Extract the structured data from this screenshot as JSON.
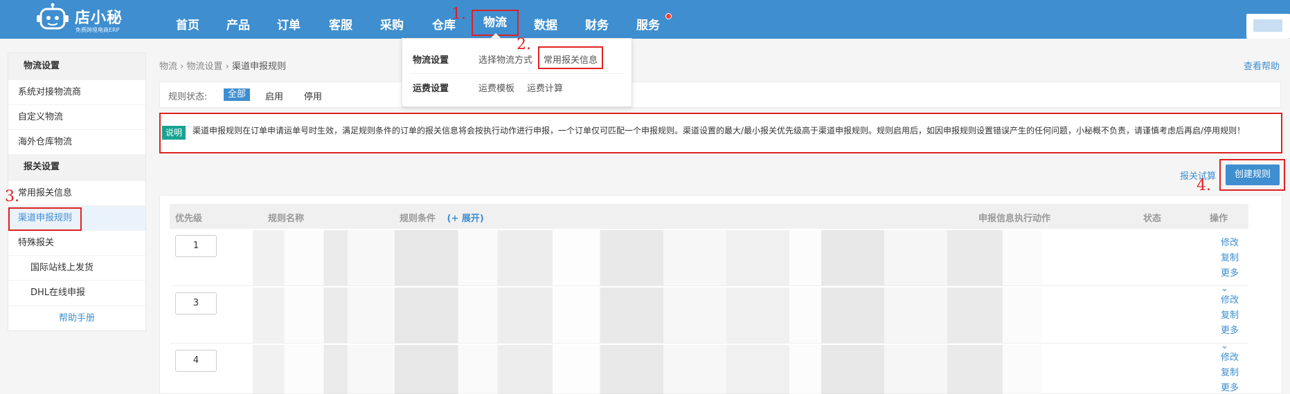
{
  "brand": {
    "title": "店小秘",
    "subtitle": "免费跨境电商ERP"
  },
  "nav": {
    "items": [
      "首页",
      "产品",
      "订单",
      "客服",
      "采购",
      "仓库",
      "物流",
      "数据",
      "财务",
      "服务"
    ],
    "active": "物流"
  },
  "dropdown": {
    "row1": {
      "head": "物流设置",
      "links": [
        "选择物流方式",
        "常用报关信息"
      ]
    },
    "row2": {
      "head": "运费设置",
      "links": [
        "运费模板",
        "运费计算"
      ]
    }
  },
  "annotations": [
    "1.",
    "2.",
    "3.",
    "4."
  ],
  "sidebar": {
    "group1": "物流设置",
    "group1_items": [
      "系统对接物流商",
      "自定义物流",
      "海外仓库物流"
    ],
    "group2": "报关设置",
    "group2_items": [
      "常用报关信息",
      "渠道申报规则",
      "特殊报关"
    ],
    "group2_sub": [
      "国际站线上发货",
      "DHL在线申报"
    ],
    "help": "帮助手册"
  },
  "breadcrumb": {
    "a": "物流",
    "b": "物流设置",
    "c": "渠道申报规则",
    "sep": "›"
  },
  "help_link": "查看帮助",
  "filter": {
    "label": "规则状态:",
    "options": [
      "全部",
      "启用",
      "停用"
    ],
    "selected": "全部"
  },
  "notice": {
    "tag": "说明",
    "text": "渠道申报规则在订单申请运单号时生效，满足规则条件的订单的报关信息将会按执行动作进行申报，一个订单仅可匹配一个申报规则。渠道设置的最大/最小报关优先级高于渠道申报规则。规则启用后，如因申报规则设置错误产生的任何问题，小秘概不负责，请谨慎考虑后再启/停用规则！"
  },
  "actions": {
    "calc": "报关试算",
    "create": "创建规则"
  },
  "table": {
    "headers": {
      "priority": "优先级",
      "name": "规则名称",
      "cond": "规则条件",
      "expand": "(+ 展开)",
      "action": "申报信息执行动作",
      "status": "状态",
      "ops": "操作"
    },
    "rows": [
      {
        "priority": "1",
        "ops": [
          "修改",
          "复制",
          "更多 ⌄"
        ]
      },
      {
        "priority": "3",
        "ops": [
          "修改",
          "复制",
          "更多 ⌄"
        ]
      },
      {
        "priority": "4",
        "ops": [
          "修改",
          "复制",
          "更多 ⌄"
        ]
      }
    ]
  }
}
